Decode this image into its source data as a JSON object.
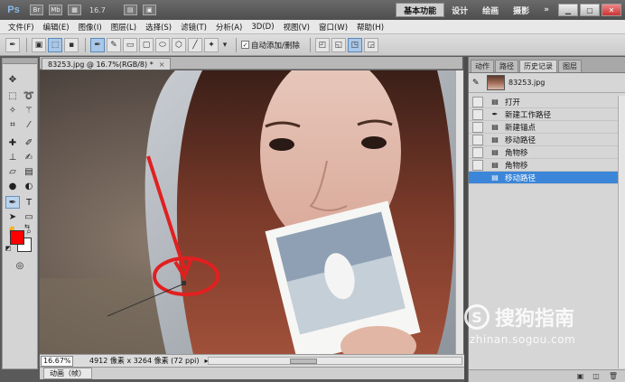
{
  "titlebar": {
    "logo": "Ps",
    "br": "Br",
    "mb": "Mb",
    "zoom": "16.7",
    "workspaces": [
      "基本功能",
      "设计",
      "绘画",
      "摄影"
    ],
    "more": "»"
  },
  "menu": [
    "文件(F)",
    "编辑(E)",
    "图像(I)",
    "图层(L)",
    "选择(S)",
    "滤镜(T)",
    "分析(A)",
    "3D(D)",
    "视图(V)",
    "窗口(W)",
    "帮助(H)"
  ],
  "options": {
    "auto_add_delete": "自动添加/删除"
  },
  "document": {
    "tab": "83253.jpg @ 16.7%(RGB/8) *",
    "close": "×"
  },
  "status": {
    "zoom": "16.67%",
    "info": "4912 像素 x 3264 像素 (72 ppi)"
  },
  "anim": {
    "label": "动画（帧）"
  },
  "colors": {
    "fg": "#ff0000",
    "bg": "#ffffff",
    "selection": "#3b86d8"
  },
  "panel": {
    "tabs": [
      "动作",
      "路径",
      "历史记录",
      "图层"
    ],
    "snapshot": "83253.jpg",
    "history": [
      {
        "label": "打开",
        "icon": "document-icon"
      },
      {
        "label": "新建工作路径",
        "icon": "pen-icon"
      },
      {
        "label": "新建锚点",
        "icon": "document-icon"
      },
      {
        "label": "移动路径",
        "icon": "document-icon"
      },
      {
        "label": "角物移",
        "icon": "document-icon"
      },
      {
        "label": "角物移",
        "icon": "document-icon"
      },
      {
        "label": "移动路径",
        "icon": "document-icon"
      }
    ]
  },
  "watermark": {
    "text": "搜狗指南",
    "url": "zhinan.sogou.com"
  }
}
